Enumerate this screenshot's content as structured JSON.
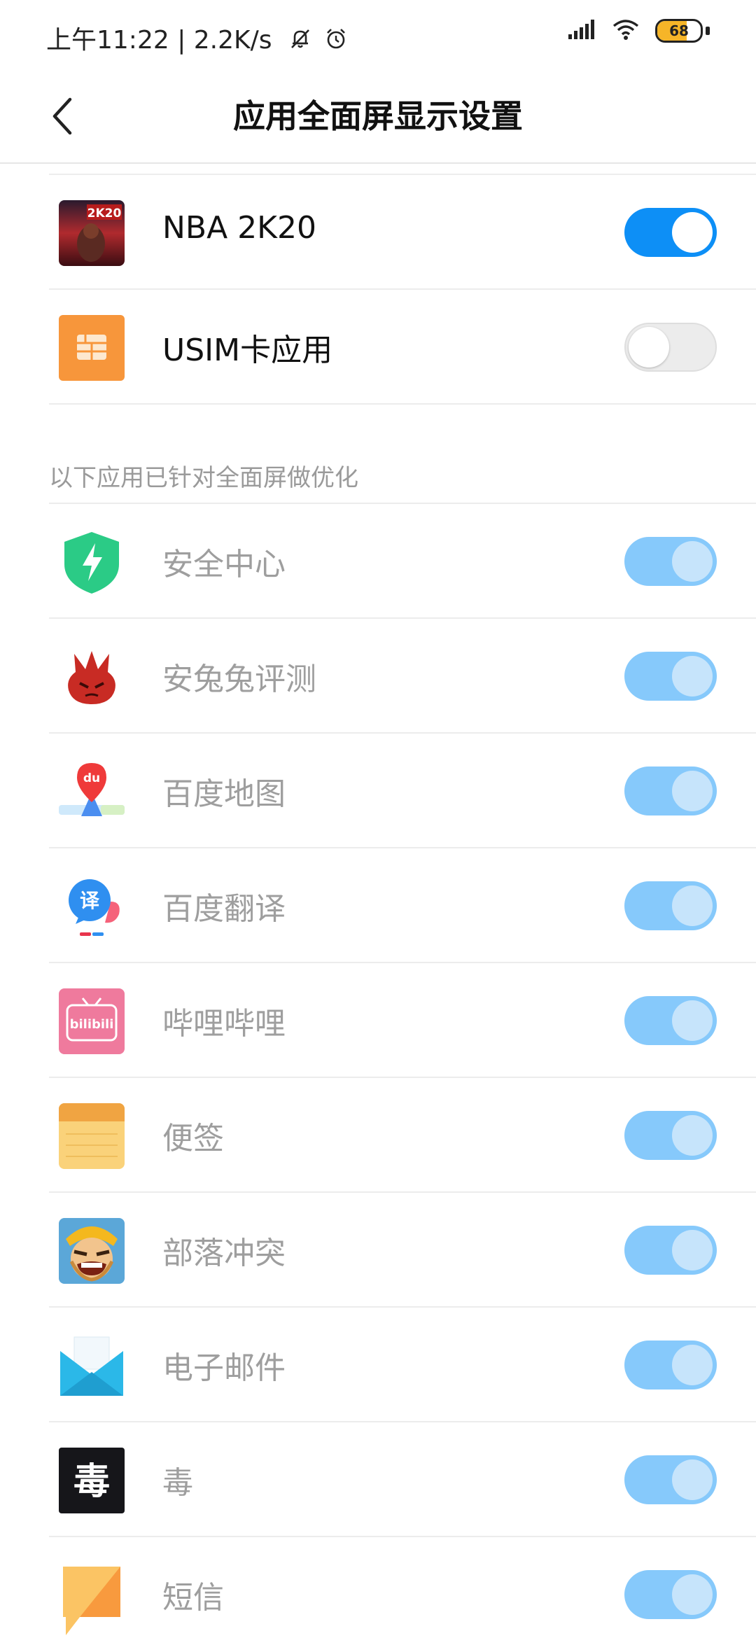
{
  "status_bar": {
    "time": "上午11:22",
    "net_speed": "2.2K/s",
    "battery": "68",
    "battery_level_percent": 68,
    "icons": [
      "silent-bell-icon",
      "alarm-icon",
      "signal-icon",
      "wifi-icon",
      "battery-icon"
    ]
  },
  "header": {
    "title": "应用全面屏显示设置",
    "back_icon": "back-chevron-icon"
  },
  "colors": {
    "toggle_on": "#0d8ff6",
    "toggle_disabled_on": "#86c9fb",
    "battery_fill": "#f6b528",
    "muted_text": "#9e9e9e"
  },
  "apps": [
    {
      "label": "NBA 2K20",
      "icon": "nba-2k20-icon",
      "toggle": "on"
    },
    {
      "label": "USIM卡应用",
      "icon": "sim-card-icon",
      "toggle": "off"
    }
  ],
  "optimized_section": {
    "header": "以下应用已针对全面屏做优化",
    "apps": [
      {
        "label": "安全中心",
        "icon": "security-center-icon",
        "toggle": "disabled-on"
      },
      {
        "label": "安兔兔评测",
        "icon": "antutu-icon",
        "toggle": "disabled-on"
      },
      {
        "label": "百度地图",
        "icon": "baidu-map-icon",
        "toggle": "disabled-on"
      },
      {
        "label": "百度翻译",
        "icon": "baidu-translate-icon",
        "toggle": "disabled-on"
      },
      {
        "label": "哔哩哔哩",
        "icon": "bilibili-icon",
        "toggle": "disabled-on"
      },
      {
        "label": "便签",
        "icon": "notes-icon",
        "toggle": "disabled-on"
      },
      {
        "label": "部落冲突",
        "icon": "clash-of-clans-icon",
        "toggle": "disabled-on"
      },
      {
        "label": "电子邮件",
        "icon": "email-icon",
        "toggle": "disabled-on"
      },
      {
        "label": "毒",
        "icon": "du-app-icon",
        "toggle": "disabled-on"
      },
      {
        "label": "短信",
        "icon": "sms-icon",
        "toggle": "disabled-on"
      }
    ]
  }
}
